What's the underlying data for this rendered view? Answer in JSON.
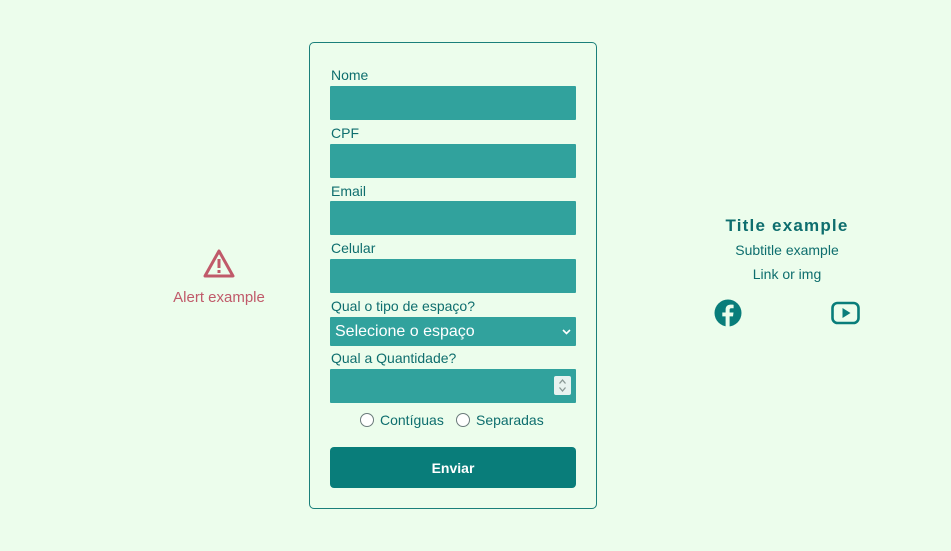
{
  "alert": {
    "text": "Alert example",
    "icon": "warning-triangle-icon",
    "color": "#c05a6a"
  },
  "form": {
    "fields": [
      {
        "label": "Nome",
        "value": ""
      },
      {
        "label": "CPF",
        "value": ""
      },
      {
        "label": "Email",
        "value": ""
      },
      {
        "label": "Celular",
        "value": ""
      }
    ],
    "space_type": {
      "label": "Qual o tipo de espaço?",
      "selected": "Selecione o espaço"
    },
    "quantity": {
      "label": "Qual a Quantidade?",
      "value": ""
    },
    "radios": [
      {
        "label": "Contíguas",
        "checked": false
      },
      {
        "label": "Separadas",
        "checked": false
      }
    ],
    "submit_label": "Enviar"
  },
  "info": {
    "title": "Title example",
    "subtitle": "Subtitle example",
    "link": "Link or img"
  },
  "social": {
    "facebook_icon": "facebook-icon",
    "youtube_icon": "youtube-icon"
  },
  "colors": {
    "background": "#ecfdec",
    "accent": "#097d7a",
    "input": "#31a29d",
    "text": "#0e6e6e"
  }
}
